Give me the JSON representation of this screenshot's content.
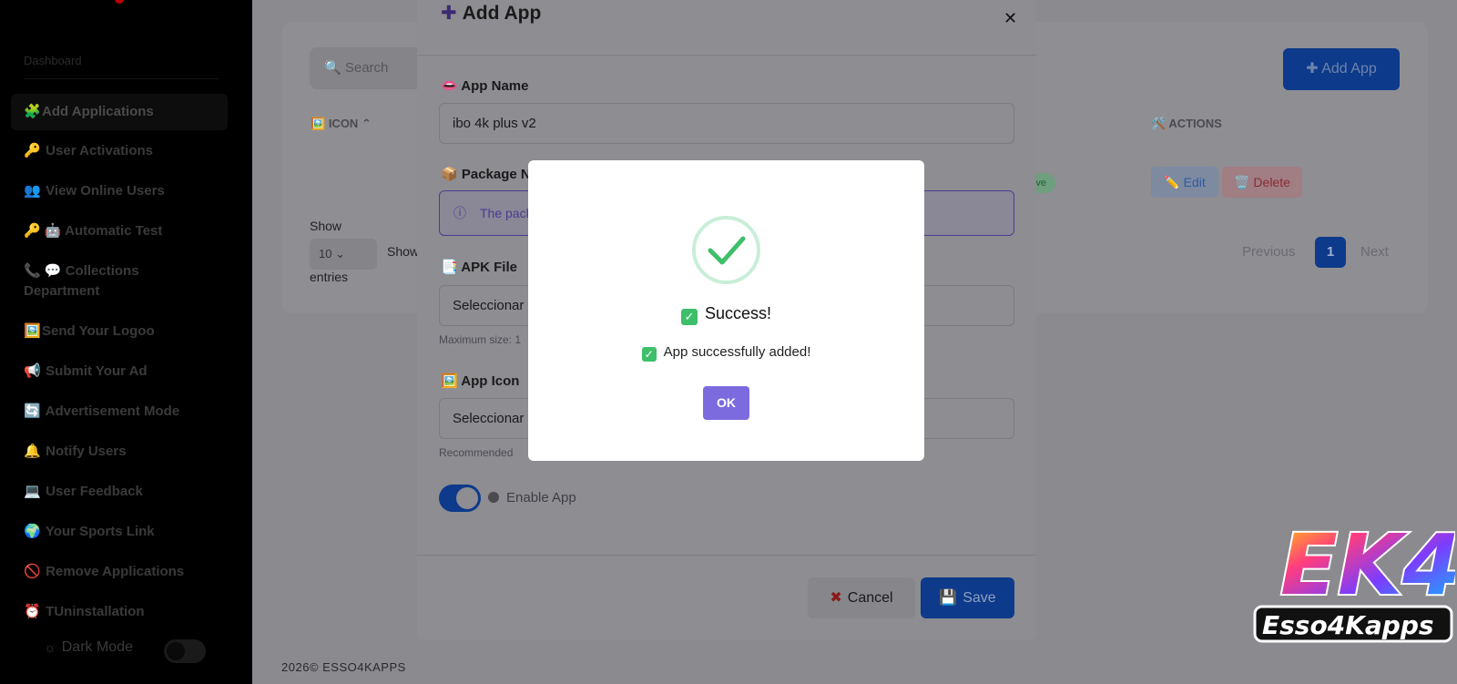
{
  "sidebar": {
    "section_title": "Dashboard",
    "items": [
      {
        "icon": "🧩",
        "label": "Add Applications",
        "active": true
      },
      {
        "icon": "🔑",
        "label": "User Activations"
      },
      {
        "icon": "👥",
        "label": "View Online Users"
      },
      {
        "icon": "🔑 🤖",
        "label": "Automatic Test"
      },
      {
        "icon": "📞 💬",
        "label": "Collections Department"
      },
      {
        "icon": "🖼️",
        "label": "Send Your Logoo"
      },
      {
        "icon": "📢",
        "label": "Submit Your Ad"
      },
      {
        "icon": "🔄",
        "label": "Advertisement Mode"
      },
      {
        "icon": "🔔",
        "label": "Notify Users"
      },
      {
        "icon": "💻",
        "label": "User Feedback"
      },
      {
        "icon": "🌍",
        "label": "Your Sports Link"
      },
      {
        "icon": "🚫",
        "label": "Remove Applications"
      },
      {
        "icon": "⏰",
        "label": "TUninstallation"
      }
    ],
    "dark_mode_label": "Dark Mode"
  },
  "background": {
    "search_placeholder": "🔍 Search",
    "add_app_label": "Add App",
    "col_icon": "ICON",
    "col_actions": "ACTIONS",
    "badge": "ive",
    "edit_label": "Edit",
    "delete_label": "Delete",
    "show_label": "Show",
    "page_size": "10",
    "show2_label": "Show",
    "entries_label": "entries",
    "previous_label": "Previous",
    "current_page": "1",
    "next_label": "Next",
    "footer": "2026©  ESSO4KAPPS"
  },
  "modal": {
    "title": "Add App",
    "app_name_label": "App Name",
    "app_name_value": "ibo 4k plus v2",
    "package_label": "Package N",
    "package_info": "The pack",
    "apk_label": "APK File",
    "apk_value": "Seleccionar",
    "apk_hint": "Maximum size: 1",
    "icon_label": "App Icon",
    "icon_value": "Seleccionar",
    "icon_hint": "Recommended",
    "enable_label": "Enable App",
    "enable_on": true,
    "cancel_label": "Cancel",
    "save_label": "Save"
  },
  "dialog": {
    "title": "Success!",
    "message": "App successfully added!",
    "ok_label": "OK"
  },
  "watermark": {
    "line1": "EK4",
    "line2": "Esso4Kapps"
  },
  "colors": {
    "accent": "#7b6bdf",
    "success": "#3fbf6a",
    "primary": "#0d3a8a"
  }
}
